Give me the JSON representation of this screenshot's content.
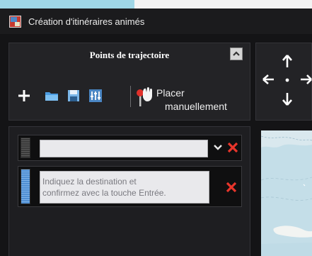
{
  "window": {
    "title": "Création d'itinéraires animés",
    "app_icon": "map-app-icon"
  },
  "trajectory_panel": {
    "heading": "Points de trajectoire",
    "collapse_icon": "chevron-up-icon",
    "toolbar": {
      "add_icon": "plus-icon",
      "open_icon": "folder-icon",
      "save_icon": "floppy-disk-icon",
      "settings_icon": "sliders-icon",
      "place_icon": "hand-pin-icon",
      "place_label_line1": "Placer",
      "place_label_line2": "manuellement"
    }
  },
  "nav_panel": {
    "icons": [
      "arrow-up-icon",
      "arrow-left-icon",
      "center-dot-icon",
      "arrow-right-icon",
      "arrow-down-icon"
    ]
  },
  "waypoints": [
    {
      "value": "",
      "has_dropdown": true,
      "grip_color": "#5a5a5a"
    },
    {
      "placeholder": "Indiquez la destination et confirmez avec la touche Entrée.",
      "placeholder_line1": "Indiquez la destination et",
      "placeholder_line2": "confirmez avec la touche Entrée.",
      "grip_color": "#4f8ed2"
    }
  ],
  "colors": {
    "background": "#141416",
    "panel": "#232326",
    "remove_red": "#e8352b",
    "accent_blue": "#4f8ed2",
    "map_water": "#c4dee8"
  }
}
